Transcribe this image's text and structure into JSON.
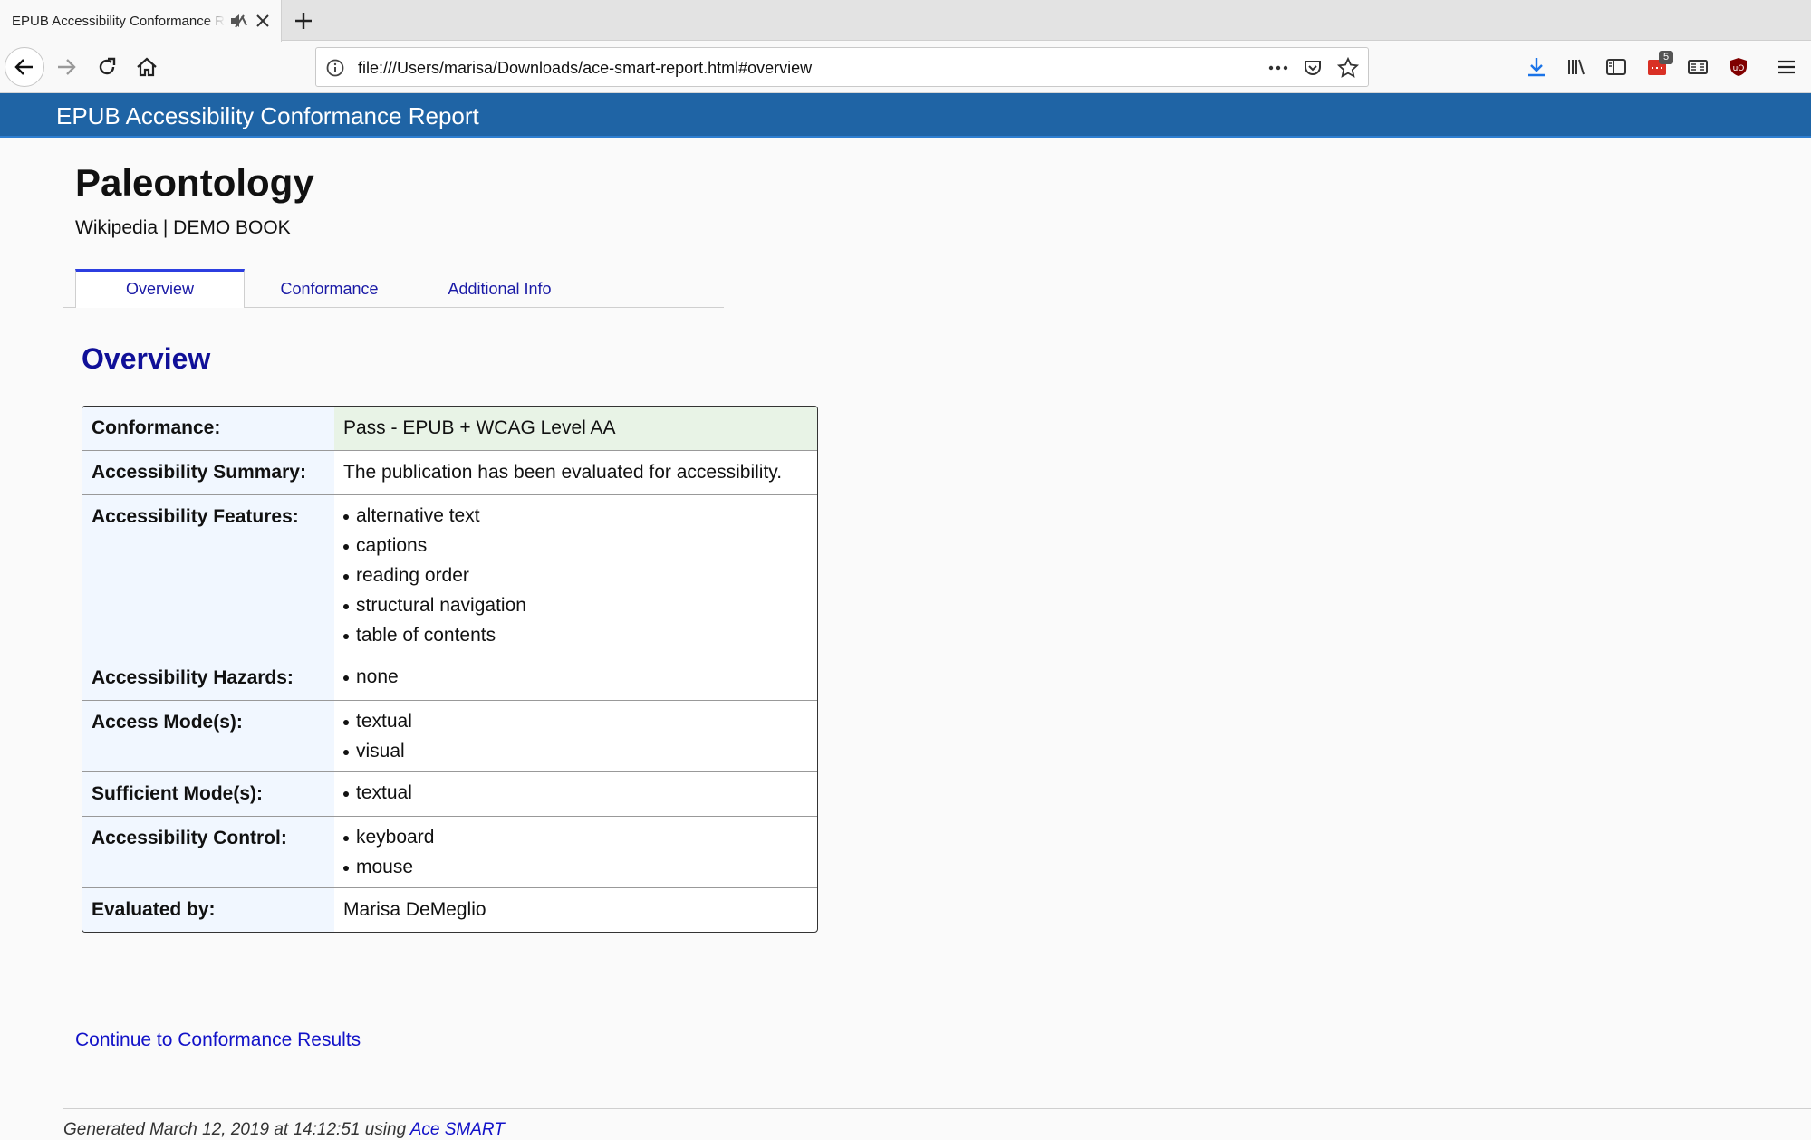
{
  "browser": {
    "tab_title": "EPUB Accessibility Conformance Report",
    "url": "file:///Users/marisa/Downloads/ace-smart-report.html#overview",
    "toolbar_badge": "5",
    "accent_color": "#1a73e8"
  },
  "header": {
    "title": "EPUB Accessibility Conformance Report",
    "background": "#1f64a5"
  },
  "book": {
    "title": "Paleontology",
    "subtitle": "Wikipedia | DEMO BOOK"
  },
  "tabs": [
    {
      "label": "Overview",
      "active": true
    },
    {
      "label": "Conformance",
      "active": false
    },
    {
      "label": "Additional Info",
      "active": false
    }
  ],
  "overview": {
    "heading": "Overview",
    "rows": {
      "conformance": {
        "label": "Conformance:",
        "value": "Pass - EPUB + WCAG Level AA"
      },
      "summary": {
        "label": "Accessibility Summary:",
        "value": "The publication has been evaluated for accessibility."
      },
      "features": {
        "label": "Accessibility Features:",
        "items": [
          "alternative text",
          "captions",
          "reading order",
          "structural navigation",
          "table of contents"
        ]
      },
      "hazards": {
        "label": "Accessibility Hazards:",
        "items": [
          "none"
        ]
      },
      "access_modes": {
        "label": "Access Mode(s):",
        "items": [
          "textual",
          "visual"
        ]
      },
      "sufficient_modes": {
        "label": "Sufficient Mode(s):",
        "items": [
          "textual"
        ]
      },
      "control": {
        "label": "Accessibility Control:",
        "items": [
          "keyboard",
          "mouse"
        ]
      },
      "evaluated_by": {
        "label": "Evaluated by:",
        "value": "Marisa DeMeglio"
      }
    }
  },
  "continue_link": "Continue to Conformance Results",
  "footer": {
    "text": "Generated March 12, 2019 at 14:12:51 using",
    "link": "Ace SMART"
  }
}
